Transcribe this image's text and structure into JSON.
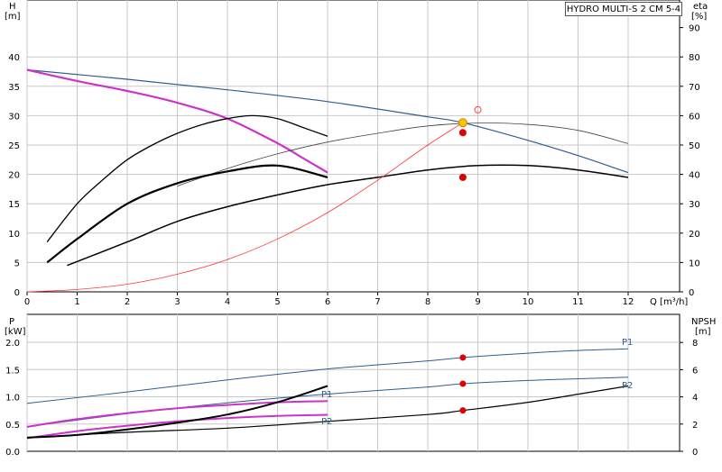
{
  "title": "HYDRO MULTI-S 2 CM 5-4",
  "top_chart": {
    "y_left_label": "H",
    "y_left_unit": "[m]",
    "y_right_label": "eta",
    "y_right_unit": "[%]",
    "x_label": "Q [m³/h]",
    "x_ticks": [
      "0",
      "1",
      "2",
      "3",
      "4",
      "5",
      "6",
      "7",
      "8",
      "9",
      "10",
      "11",
      "12"
    ],
    "y_left_ticks": [
      "0",
      "5",
      "10",
      "15",
      "20",
      "25",
      "30",
      "35",
      "40"
    ],
    "y_right_ticks": [
      "0",
      "10",
      "20",
      "30",
      "40",
      "50",
      "60",
      "70",
      "80",
      "90"
    ]
  },
  "bottom_chart": {
    "y_left_label": "P",
    "y_left_unit": "[kW]",
    "y_right_label": "NPSH",
    "y_right_unit": "[m]",
    "y_left_ticks": [
      "0.0",
      "0.5",
      "1.0",
      "1.5",
      "2.0"
    ],
    "y_right_ticks": [
      "0",
      "2",
      "4",
      "6",
      "8"
    ],
    "labels": {
      "p1_main": "P1",
      "p2_main": "P2",
      "p1_partial": "P1",
      "p2_partial": "P2"
    }
  },
  "chart_data": [
    {
      "type": "line",
      "title": "HYDRO MULTI-S 2 CM 5-4",
      "xlabel": "Q [m³/h]",
      "ylabel": "H [m]",
      "y2label": "eta [%]",
      "xlim": [
        0,
        12.3
      ],
      "ylim": [
        0,
        45
      ],
      "y2lim": [
        0,
        100
      ],
      "grid": true,
      "series": [
        {
          "role": "head-full-speed",
          "color": "#2e5d8e",
          "axis": "left",
          "x": [
            0,
            2,
            4,
            6,
            8,
            8.7,
            10,
            11,
            12
          ],
          "y": [
            37.8,
            36.2,
            34.4,
            32.4,
            29.8,
            28.8,
            25.8,
            23.2,
            20.3
          ]
        },
        {
          "role": "head-reduced-speed",
          "color": "#cc33cc",
          "axis": "left",
          "x": [
            0,
            1,
            2,
            3,
            4,
            5,
            5.5,
            6
          ],
          "y": [
            37.8,
            35.9,
            34.2,
            32.2,
            29.5,
            25.3,
            22.8,
            20.3
          ]
        },
        {
          "role": "efficiency-full-speed",
          "color": "#444444",
          "axis": "right",
          "x": [
            3,
            4,
            5,
            6,
            7,
            8,
            9,
            10,
            11,
            12
          ],
          "y": [
            36,
            42,
            47,
            51,
            54,
            56.5,
            57.5,
            57,
            55,
            50.5
          ]
        },
        {
          "role": "efficiency-reduced",
          "color": "#000000",
          "axis": "right",
          "x": [
            0.4,
            1,
            1.5,
            2,
            2.5,
            3,
            3.5,
            4,
            4.5,
            5,
            5.5,
            6
          ],
          "y": [
            17,
            30,
            38,
            45,
            50,
            54,
            57,
            59,
            60,
            59,
            56,
            53
          ]
        },
        {
          "role": "efficiency-partial",
          "color": "#000000",
          "axis": "right",
          "x": [
            0.4,
            1,
            2,
            3,
            4,
            5,
            6
          ],
          "y": [
            10,
            18,
            30,
            37,
            41,
            43,
            39
          ]
        },
        {
          "role": "hydraulic-efficiency",
          "color": "#000000",
          "axis": "right",
          "x": [
            0.8,
            2,
            3,
            4,
            5,
            6,
            7,
            8,
            9,
            10,
            11,
            12
          ],
          "y": [
            9,
            17,
            24,
            29,
            33,
            36.5,
            39,
            41.5,
            43,
            43,
            41.5,
            39
          ]
        },
        {
          "role": "system-curve",
          "color": "#ff3333",
          "axis": "left",
          "x": [
            0,
            1,
            2,
            3,
            4,
            5,
            6,
            7,
            8,
            8.7
          ],
          "y": [
            0,
            0.4,
            1.3,
            3,
            5.5,
            9,
            13.5,
            19,
            25,
            28.8
          ]
        }
      ],
      "points": [
        {
          "role": "duty-point",
          "x": 8.7,
          "y": 28.8,
          "color": "#f5c400"
        },
        {
          "role": "eta-marker-1",
          "x": 8.7,
          "y": 27.1,
          "color": "#e00000"
        },
        {
          "role": "eta-marker-2",
          "x": 8.7,
          "y": 19.5,
          "color": "#e00000"
        },
        {
          "role": "open-marker",
          "x": 9.0,
          "y": 31.0,
          "color": "#ff4444"
        }
      ]
    },
    {
      "type": "line",
      "ylabel": "P [kW]",
      "y2label": "NPSH [m]",
      "xlim": [
        0,
        12.3
      ],
      "ylim": [
        0,
        2.25
      ],
      "y2lim": [
        0,
        9
      ],
      "grid": true,
      "series": [
        {
          "name": "P1",
          "color": "#2e5d8e",
          "axis": "left",
          "x": [
            0,
            2,
            4,
            6,
            8,
            8.7,
            10,
            11,
            12
          ],
          "y": [
            0.88,
            1.09,
            1.31,
            1.51,
            1.66,
            1.72,
            1.8,
            1.85,
            1.88
          ]
        },
        {
          "name": "P2",
          "color": "#2e5d8e",
          "axis": "left",
          "x": [
            0,
            2,
            4,
            6,
            8,
            8.7,
            10,
            11,
            12
          ],
          "y": [
            0.45,
            0.69,
            0.89,
            1.05,
            1.18,
            1.24,
            1.3,
            1.33,
            1.36
          ]
        },
        {
          "role": "npsh",
          "color": "#000000",
          "axis": "right",
          "x": [
            0,
            2,
            4,
            6,
            8,
            8.7,
            10,
            11,
            12
          ],
          "y": [
            1.0,
            1.4,
            1.7,
            2.2,
            2.7,
            3.0,
            3.6,
            4.2,
            4.8
          ]
        },
        {
          "name": "P1",
          "color": "#cc33cc",
          "axis": "left",
          "x": [
            0,
            1,
            2,
            3,
            4,
            5,
            6
          ],
          "y": [
            0.45,
            0.59,
            0.7,
            0.79,
            0.85,
            0.9,
            0.92
          ]
        },
        {
          "name": "P2",
          "color": "#cc33cc",
          "axis": "left",
          "x": [
            0,
            1,
            2,
            3,
            4,
            5,
            6
          ],
          "y": [
            0.24,
            0.37,
            0.47,
            0.55,
            0.61,
            0.65,
            0.67
          ]
        },
        {
          "role": "npsh-partial",
          "color": "#000000",
          "axis": "right",
          "x": [
            0,
            1,
            2,
            3,
            4,
            5,
            6
          ],
          "y": [
            1.0,
            1.2,
            1.6,
            2.1,
            2.7,
            3.6,
            4.8
          ]
        }
      ],
      "points": [
        {
          "x": 8.7,
          "y": 1.72,
          "color": "#e00000"
        },
        {
          "x": 8.7,
          "y": 1.24,
          "color": "#e00000"
        },
        {
          "x": 8.7,
          "y": 0.75,
          "color": "#e00000"
        }
      ]
    }
  ]
}
